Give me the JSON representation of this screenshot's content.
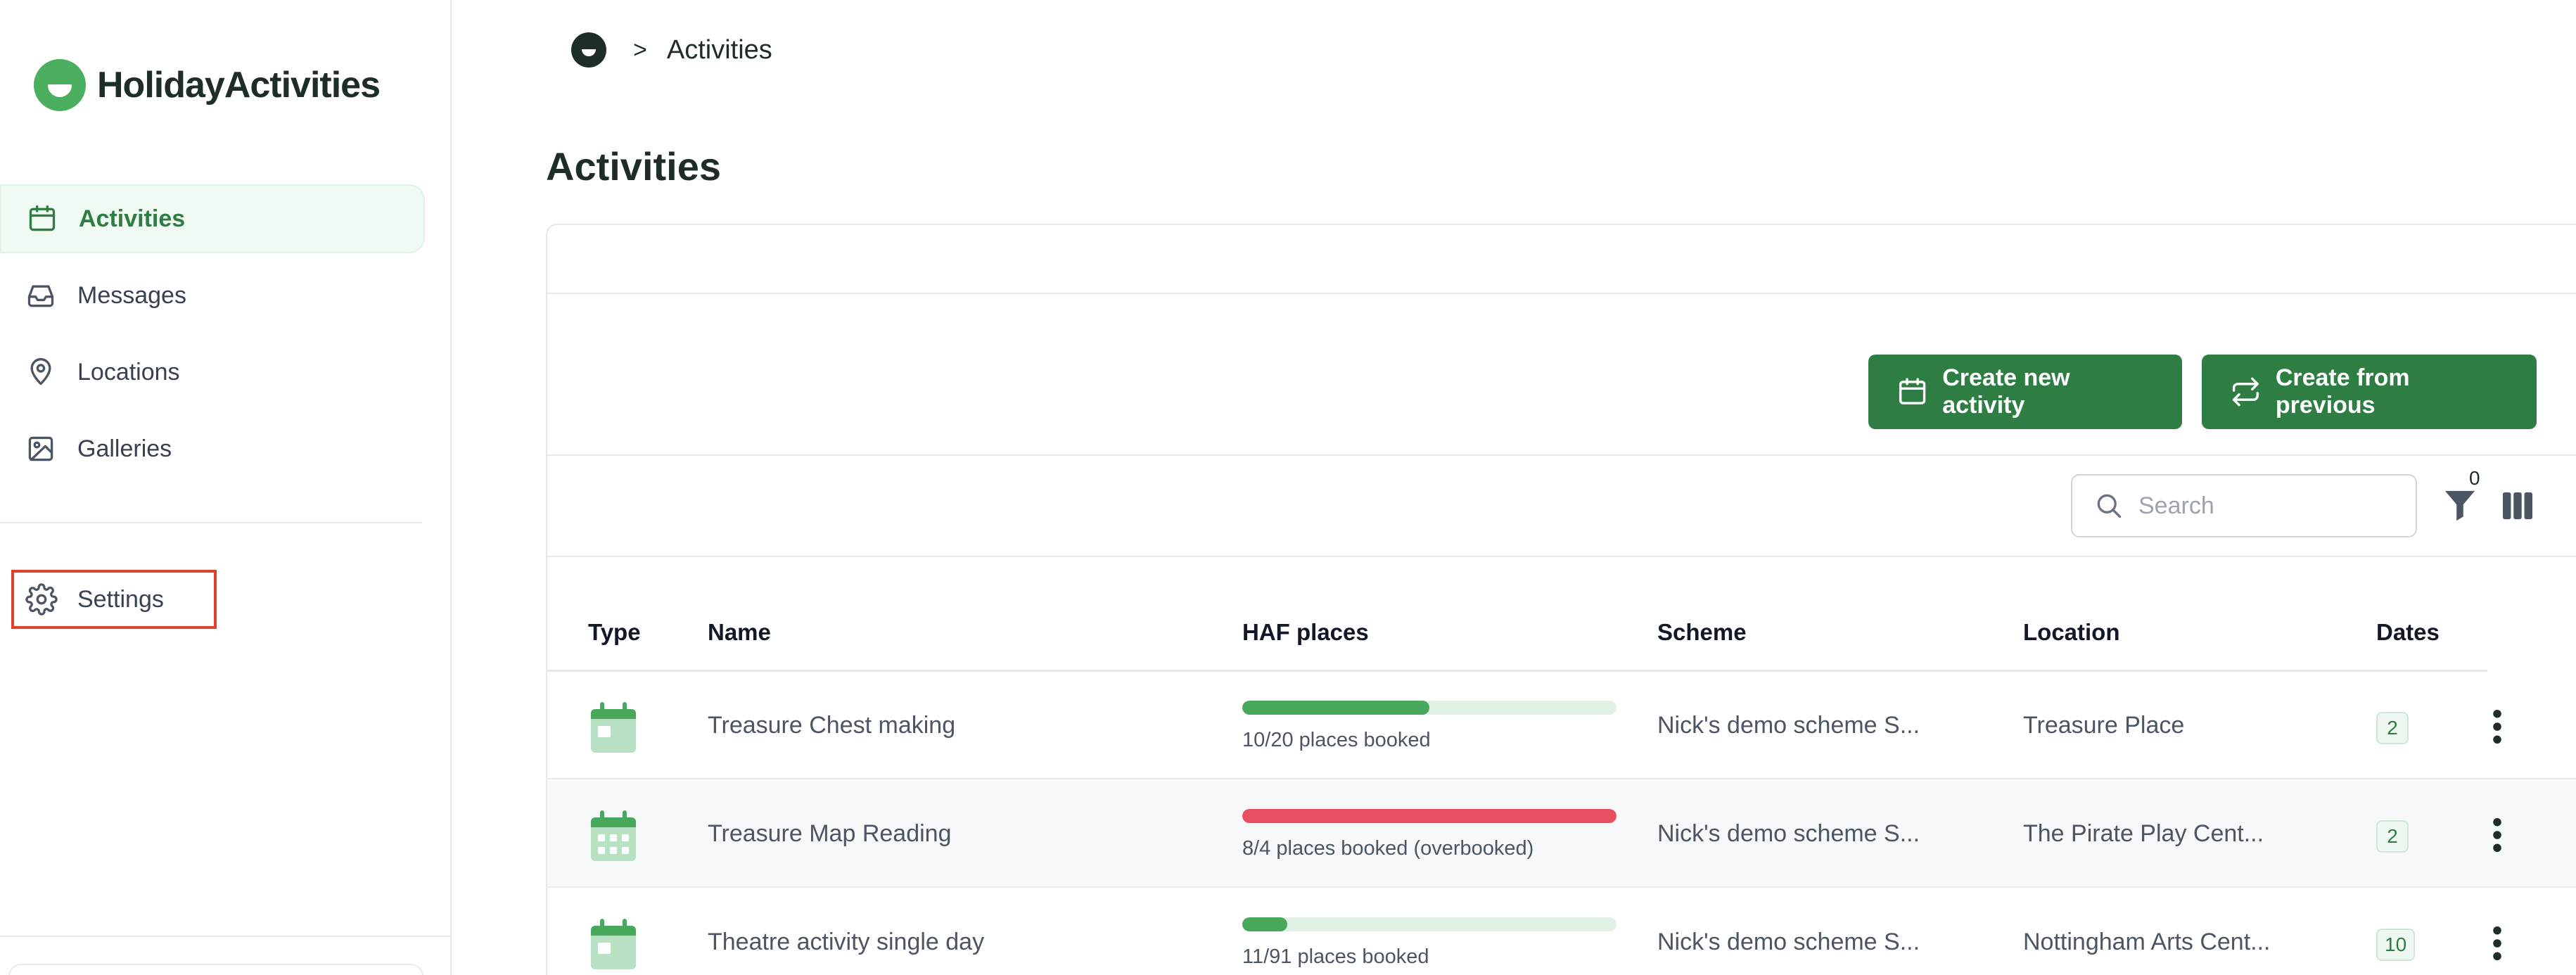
{
  "app": {
    "brand": "HolidayActivities"
  },
  "sidebar": {
    "items": [
      {
        "label": "Activities",
        "icon": "calendar-icon",
        "active": true
      },
      {
        "label": "Messages",
        "icon": "inbox-icon",
        "active": false
      },
      {
        "label": "Locations",
        "icon": "map-pin-icon",
        "active": false
      },
      {
        "label": "Galleries",
        "icon": "image-icon",
        "active": false
      }
    ],
    "settings_label": "Settings"
  },
  "breadcrumb": {
    "current": "Activities",
    "separator": ">"
  },
  "page": {
    "title": "Activities"
  },
  "toolbar": {
    "create_new_label": "Create new activity",
    "create_from_previous_label": "Create from previous",
    "search_placeholder": "Search",
    "filter_count": "0"
  },
  "table": {
    "columns": [
      "Type",
      "Name",
      "HAF places",
      "Scheme",
      "Location",
      "Dates"
    ],
    "rows": [
      {
        "type_icon": "calendar-single-icon",
        "name": "Treasure Chest making",
        "booked": 10,
        "capacity": 20,
        "places_text": "10/20 places booked",
        "overbooked": false,
        "scheme": "Nick's demo scheme S...",
        "location": "Treasure Place",
        "dates": "2"
      },
      {
        "type_icon": "calendar-multi-icon",
        "name": "Treasure Map Reading",
        "booked": 8,
        "capacity": 4,
        "places_text": "8/4 places booked (overbooked)",
        "overbooked": true,
        "scheme": "Nick's demo scheme S...",
        "location": "The Pirate Play Cent...",
        "dates": "2"
      },
      {
        "type_icon": "calendar-single-icon",
        "name": "Theatre activity single day",
        "booked": 11,
        "capacity": 91,
        "places_text": "11/91 places booked",
        "overbooked": false,
        "scheme": "Nick's demo scheme S...",
        "location": "Nottingham Arts Cent...",
        "dates": "10"
      }
    ]
  },
  "colors": {
    "brand_green": "#4caf60",
    "button_green": "#2e7d43",
    "bar_fill": "#48a85c",
    "bar_track": "#e2f1e5",
    "overbooked": "#e85061",
    "highlight_box": "#e0412b"
  }
}
